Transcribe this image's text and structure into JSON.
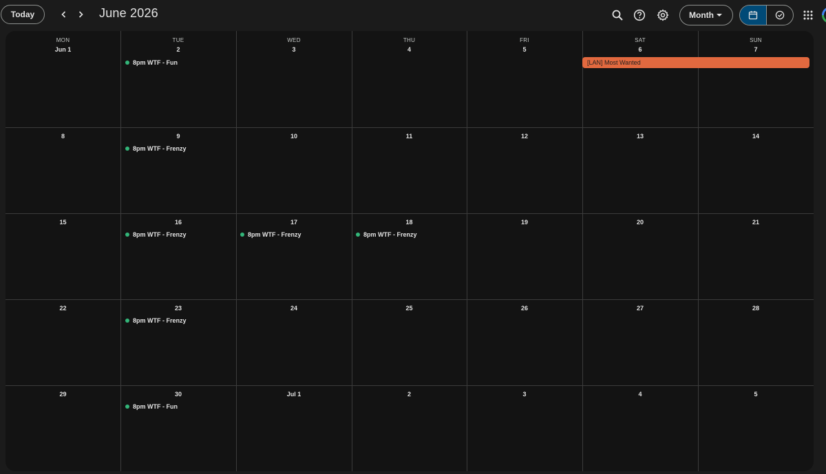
{
  "toolbar": {
    "today_label": "Today",
    "prev_icon": "chevron-left-icon",
    "next_icon": "chevron-right-icon",
    "title": "June 2026",
    "view_label": "Month"
  },
  "colors": {
    "event_dot": "#33b679",
    "allday_event": "#e2693f",
    "active_view": "#004a77"
  },
  "weekdays": [
    "MON",
    "TUE",
    "WED",
    "THU",
    "FRI",
    "SAT",
    "SUN"
  ],
  "weeks": [
    [
      "Jun 1",
      "2",
      "3",
      "4",
      "5",
      "6",
      "7"
    ],
    [
      "8",
      "9",
      "10",
      "11",
      "12",
      "13",
      "14"
    ],
    [
      "15",
      "16",
      "17",
      "18",
      "19",
      "20",
      "21"
    ],
    [
      "22",
      "23",
      "24",
      "25",
      "26",
      "27",
      "28"
    ],
    [
      "29",
      "30",
      "Jul 1",
      "2",
      "3",
      "4",
      "5"
    ]
  ],
  "events": {
    "w1_tue": "8pm WTF - Fun",
    "w2_tue": "8pm WTF - Frenzy",
    "w3_tue": "8pm WTF - Frenzy",
    "w3_wed": "8pm WTF - Frenzy",
    "w3_thu": "8pm WTF - Frenzy",
    "w4_tue": "8pm WTF - Frenzy",
    "w5_tue": "8pm WTF - Fun",
    "allday_sat_sun": "[LAN] Most Wanted"
  }
}
